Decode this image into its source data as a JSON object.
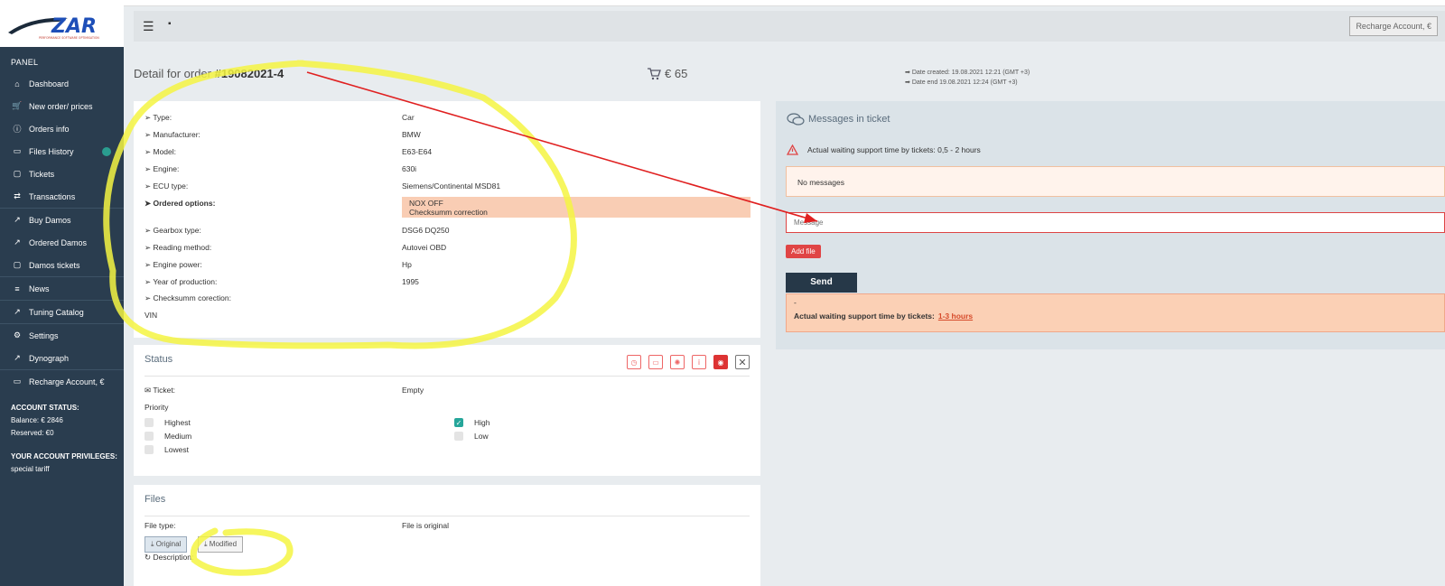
{
  "logo_text": "ZAR",
  "logo_subtext": "PERFORMANCE SOFTWARE OPTIMISATION",
  "sidebar": {
    "panel_label": "PANEL",
    "items": [
      {
        "label": "Dashboard",
        "icon": "home-icon"
      },
      {
        "label": "New order/ prices",
        "icon": "cart-icon"
      },
      {
        "label": "Orders info",
        "icon": "info-icon"
      },
      {
        "label": "Files History",
        "icon": "folder-icon"
      },
      {
        "label": "Tickets",
        "icon": "chat-icon"
      },
      {
        "label": "Transactions",
        "icon": "transactions-icon"
      },
      {
        "label": "Buy Damos",
        "icon": "chart-icon"
      },
      {
        "label": "Ordered Damos",
        "icon": "chart-icon"
      },
      {
        "label": "Damos tickets",
        "icon": "chat-icon"
      },
      {
        "label": "News",
        "icon": "list-icon"
      },
      {
        "label": "Tuning Catalog",
        "icon": "chart-icon"
      },
      {
        "label": "Settings",
        "icon": "gear-icon"
      },
      {
        "label": "Dynograph",
        "icon": "chart-icon"
      },
      {
        "label": "Recharge Account, €",
        "icon": "wallet-icon"
      }
    ],
    "account_status_label": "ACCOUNT STATUS:",
    "balance": "Balance: € 2846",
    "reserved": "Reserved: €0",
    "privileges_label": "YOUR ACCOUNT PRIVILEGES:",
    "privilege": "special tariff"
  },
  "topbar": {
    "recharge_label": "Recharge Account, €"
  },
  "order": {
    "title_prefix": "Detail for order",
    "number": "#19082021-4",
    "price": "€ 65",
    "date_created": "Date created: 19.08.2021 12:21 (GMT +3)",
    "date_end": "Date end 19.08.2021 12:24 (GMT +3)"
  },
  "details": {
    "type_label": "➢ Type:",
    "type": "Car",
    "manufacturer_label": "➢ Manufacturer:",
    "manufacturer": "BMW",
    "model_label": "➢ Model:",
    "model": "E63-E64",
    "engine_label": "➢ Engine:",
    "engine": "630i",
    "ecu_label": "➢ ECU type:",
    "ecu": "Siemens/Continental MSD81",
    "options_label": "➤ Ordered options:",
    "options": [
      "NOX OFF",
      "Checksumm correction"
    ],
    "gearbox_label": "➢ Gearbox type:",
    "gearbox": "DSG6 DQ250",
    "reading_label": "➢ Reading method:",
    "reading": "Autovei OBD",
    "power_label": "➢ Engine power:",
    "power": "Hp",
    "year_label": "➢ Year of production:",
    "year": "1995",
    "checksumm_label": "➢ Checksumm corection:",
    "vin_label": "VIN"
  },
  "status": {
    "title": "Status",
    "ticket_label": "✉ Ticket:",
    "ticket_value": "Empty",
    "priority_label": "Priority",
    "priorities_left": [
      "Highest",
      "Medium",
      "Lowest"
    ],
    "priorities_right": [
      "High",
      "Low"
    ],
    "checked": "High"
  },
  "files": {
    "title": "Files",
    "file_type_label": "File type:",
    "file_type_value": "File is original",
    "original_btn": "Original",
    "modified_btn": "Modified",
    "description_label": "Description:"
  },
  "messages": {
    "title": "Messages in ticket",
    "wait_info": "Actual waiting support time by tickets: 0,5 - 2 hours",
    "no_messages": "No messages",
    "input_placeholder": "Message",
    "add_file": "Add file",
    "send": "Send",
    "wait_box_dash": "-",
    "wait_box_label": "Actual waiting support time by tickets:",
    "wait_box_value": "1-3 hours"
  },
  "colors": {
    "sidebar_bg": "#2a3d4f",
    "accent_red": "#e04545",
    "options_bg": "#f9cdb4",
    "annotation_yellow": "#f5f542",
    "annotation_arrow": "#e02020"
  }
}
